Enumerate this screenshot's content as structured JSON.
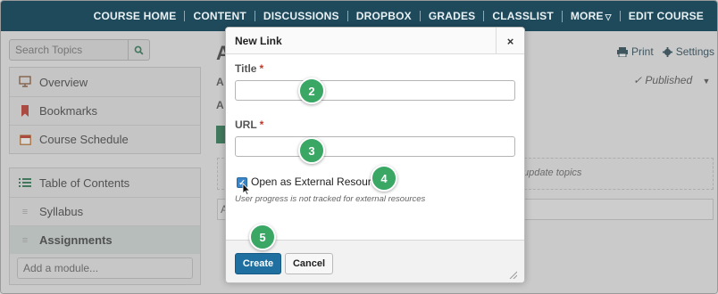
{
  "nav": {
    "items": [
      "COURSE HOME",
      "CONTENT",
      "DISCUSSIONS",
      "DROPBOX",
      "GRADES",
      "CLASSLIST",
      "MORE",
      "EDIT COURSE"
    ],
    "more_caret": "▽"
  },
  "sidebar": {
    "search_placeholder": "Search Topics",
    "top_items": [
      "Overview",
      "Bookmarks",
      "Course Schedule"
    ],
    "toc_label": "Table of Contents",
    "modules": [
      "Syllabus",
      "Assignments"
    ],
    "add_module_placeholder": "Add a module..."
  },
  "content": {
    "print_label": "Print",
    "settings_label": "Settings",
    "status_label": "Published",
    "drop_hint": "update topics",
    "heading_fragment": "A",
    "row_letter": "A",
    "row_letter2": "A",
    "input_fragment": "A"
  },
  "dialog": {
    "title": "New Link",
    "close_glyph": "×",
    "title_label": "Title",
    "url_label": "URL",
    "required_mark": "*",
    "external_checkbox_label": "Open as External Resource",
    "external_checked": true,
    "help_text": "User progress is not tracked for external resources",
    "create_label": "Create",
    "cancel_label": "Cancel"
  },
  "callouts": [
    "2",
    "3",
    "4",
    "5"
  ],
  "colors": {
    "nav_bg": "#1f4a5c",
    "primary_button": "#1f6fa0",
    "callout": "#3aa765",
    "required": "#c0392b"
  }
}
